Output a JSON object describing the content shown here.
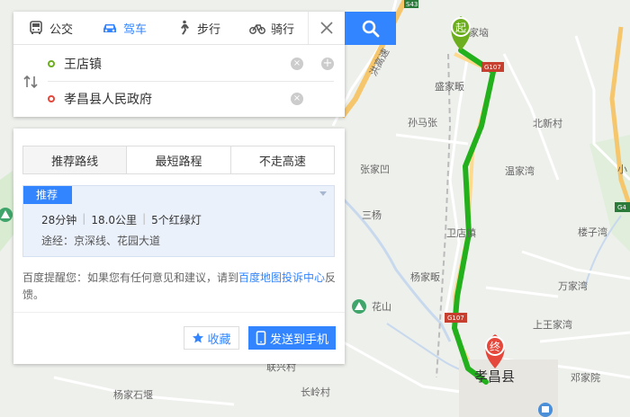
{
  "modes": [
    {
      "label": "公交",
      "icon": "bus-icon"
    },
    {
      "label": "驾车",
      "icon": "car-icon"
    },
    {
      "label": "步行",
      "icon": "walk-icon"
    },
    {
      "label": "骑行",
      "icon": "bike-icon"
    }
  ],
  "route": {
    "start": "王店镇",
    "end": "孝昌县人民政府"
  },
  "tabs": [
    "推荐路线",
    "最短路程",
    "不走高速"
  ],
  "plan": {
    "badge": "推荐",
    "time": "28分钟",
    "distance": "18.0公里",
    "lights": "5个红绿灯",
    "via": "途经：京深线、花园大道"
  },
  "tip": {
    "prefix": "百度提醒您：如果您有任何意见和建议，请到",
    "link": "百度地图投诉中心",
    "suffix": "反馈。"
  },
  "buttons": {
    "favorite": "收藏",
    "send": "发送到手机"
  },
  "map": {
    "start_marker": "起",
    "end_marker": "终",
    "labels": [
      "黎家垴",
      "盛家畈",
      "孙马张",
      "北新村",
      "张家凹",
      "温家湾",
      "三杨",
      "卫店镇",
      "楼子湾",
      "杨家畈",
      "万家湾",
      "花山",
      "上王家湾",
      "联兴村",
      "孝昌县",
      "邓家院",
      "杨家石堰",
      "长岭村",
      "小"
    ],
    "highway_label": "洪高速",
    "shields": [
      "S43",
      "G107",
      "G107",
      "G4"
    ],
    "colors": {
      "route": "#22b01c",
      "accent": "#3385ff",
      "end": "#e5473a",
      "start": "#6cae1e"
    }
  }
}
